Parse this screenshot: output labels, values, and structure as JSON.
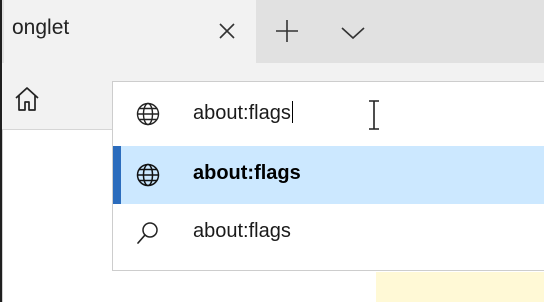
{
  "tab": {
    "title": "onglet",
    "close_icon": "close-icon",
    "new_tab_icon": "plus-icon",
    "menu_icon": "chevron-down-icon"
  },
  "toolbar": {
    "home_icon": "home-icon"
  },
  "address_bar": {
    "value": "about:flags",
    "icon": "globe-icon"
  },
  "suggestions": [
    {
      "text": "about:flags",
      "icon": "globe-icon",
      "highlighted": true
    },
    {
      "text": "about:flags",
      "icon": "search-icon",
      "highlighted": false
    }
  ],
  "colors": {
    "highlight": "#cce8ff",
    "accent": "#2b6cbd",
    "tabbar": "#e1e1e1",
    "tab_active": "#f2f2f2"
  }
}
